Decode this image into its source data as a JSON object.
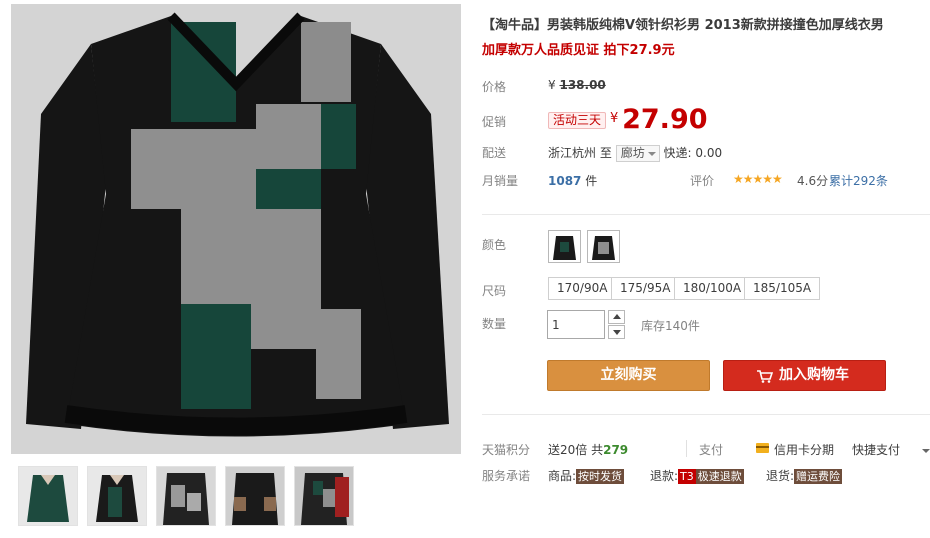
{
  "product": {
    "title": "【淘牛品】男装韩版纯棉V领针织衫男 2013新款拼接撞色加厚线衣男",
    "subtitle": "加厚款万人品质见证 拍下27.9元"
  },
  "price": {
    "label": "价格",
    "currency": "¥",
    "original": "138.00"
  },
  "promotion": {
    "label": "促销",
    "tag": "活动三天",
    "currency": "¥",
    "price": "27.90"
  },
  "shipping": {
    "label": "配送",
    "origin": "浙江杭州",
    "to": "至",
    "destination": "廊坊",
    "express": "快递: 0.00"
  },
  "sales": {
    "label": "月销量",
    "count": "1087",
    "unit": "件",
    "rating_label": "评价",
    "stars": "★★★★★",
    "score": "4.6分",
    "reviews": "累计292条"
  },
  "options": {
    "color_label": "颜色",
    "size_label": "尺码",
    "sizes": [
      "170/90A",
      "175/95A",
      "180/100A",
      "185/105A"
    ],
    "qty_label": "数量",
    "qty_value": "1",
    "stock": "库存140件"
  },
  "actions": {
    "buy_now": "立刻购买",
    "add_to_cart": "加入购物车"
  },
  "extras": {
    "points_label": "天猫积分",
    "points_text_pre": "送20倍 共",
    "points_value": "279",
    "pay_label": "支付",
    "credit": "信用卡分期",
    "fastpay": "快捷支付",
    "service_label": "服务承诺",
    "goods_label": "商品:",
    "goods_badge": "按时发货",
    "refund_label": "退款:",
    "refund_code": "T3",
    "refund_badge": "极速退款",
    "return_label": "退货:",
    "return_badge": "赠运费险"
  },
  "colors": {
    "accent": "#c40000",
    "buy_button": "#d9903f",
    "cart_button": "#d42b1e",
    "link": "#3c6fa6",
    "star": "#f5a623"
  }
}
